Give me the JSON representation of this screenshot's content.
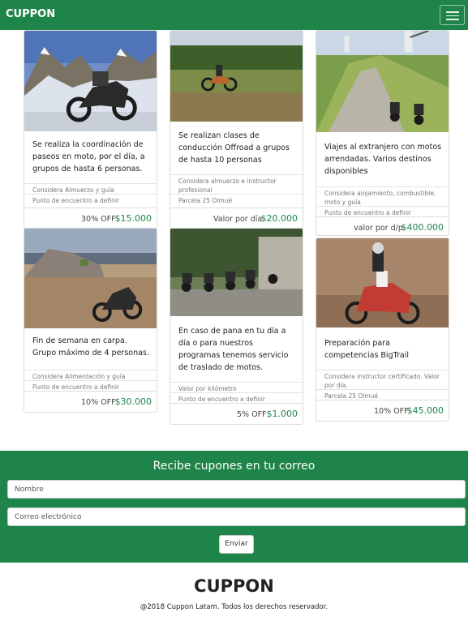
{
  "navbar": {
    "brand": "CUPPON",
    "menu_icon": "hamburger-menu-icon"
  },
  "cards": [
    {
      "image": "motorcycle-snowy-mountain",
      "description": "Se realiza la coordinación de paseos en moto, por el día, a grupos de hasta 6 personas.",
      "details": [
        "Considera Almuerzo y guía",
        "Punto de encuentro a definir"
      ],
      "label": "30% OFF",
      "price": "$15.000"
    },
    {
      "image": "offroad-rider-field",
      "description": "Se realizan clases de conducción Offroad a grupos de hasta 10 personas",
      "details": [
        "Considera almuerzo e instructor profesional",
        "Parcela 25 Olmué"
      ],
      "label": "Valor por día",
      "price": "$20.000"
    },
    {
      "image": "motorcycles-windmill-road",
      "description": "Viajes al extranjero con motos arrendadas. Varios destinos disponibles",
      "details": [
        "Considera alojamiento, combustible, moto y guía",
        "Punto de encuentro a definir"
      ],
      "label": "valor por d/p",
      "price": "$400.000"
    },
    {
      "image": "motorcycle-beach-camp",
      "description": "Fin de semana en carpa. Grupo máximo de 4 personas.",
      "details": [
        "Considera Alimentación y guía",
        "Punto de encuentro a definir"
      ],
      "label": "10% OFF",
      "price": "$30.000"
    },
    {
      "image": "motorcycles-truck-forest",
      "description": "En caso de pana en tu día a día o para nuestros programas tenemos servicio de traslado de motos.",
      "details": [
        "Valor por kilómetro",
        "Punto de encuentro a definir"
      ],
      "label": "5% OFF",
      "price": "$1.000"
    },
    {
      "image": "rider-bigtrail-dirt",
      "description": "Preparación para competencias BigTrail",
      "details": [
        "Considera instructor certificado. Valor por día.",
        "Parcela 25 Olmué"
      ],
      "label": "10% OFF",
      "price": "$45.000"
    }
  ],
  "subscribe": {
    "title": "Recibe cupones en tu correo",
    "name_placeholder": "Nombre",
    "email_placeholder": "Correo electrónico",
    "button_label": "Enviar"
  },
  "footer": {
    "brand": "CUPPON",
    "copyright": "@2018 Cuppon Latam. Todos los derechos reservador."
  },
  "colors": {
    "brand_green": "#1e8449",
    "price_green": "#1e8449"
  }
}
